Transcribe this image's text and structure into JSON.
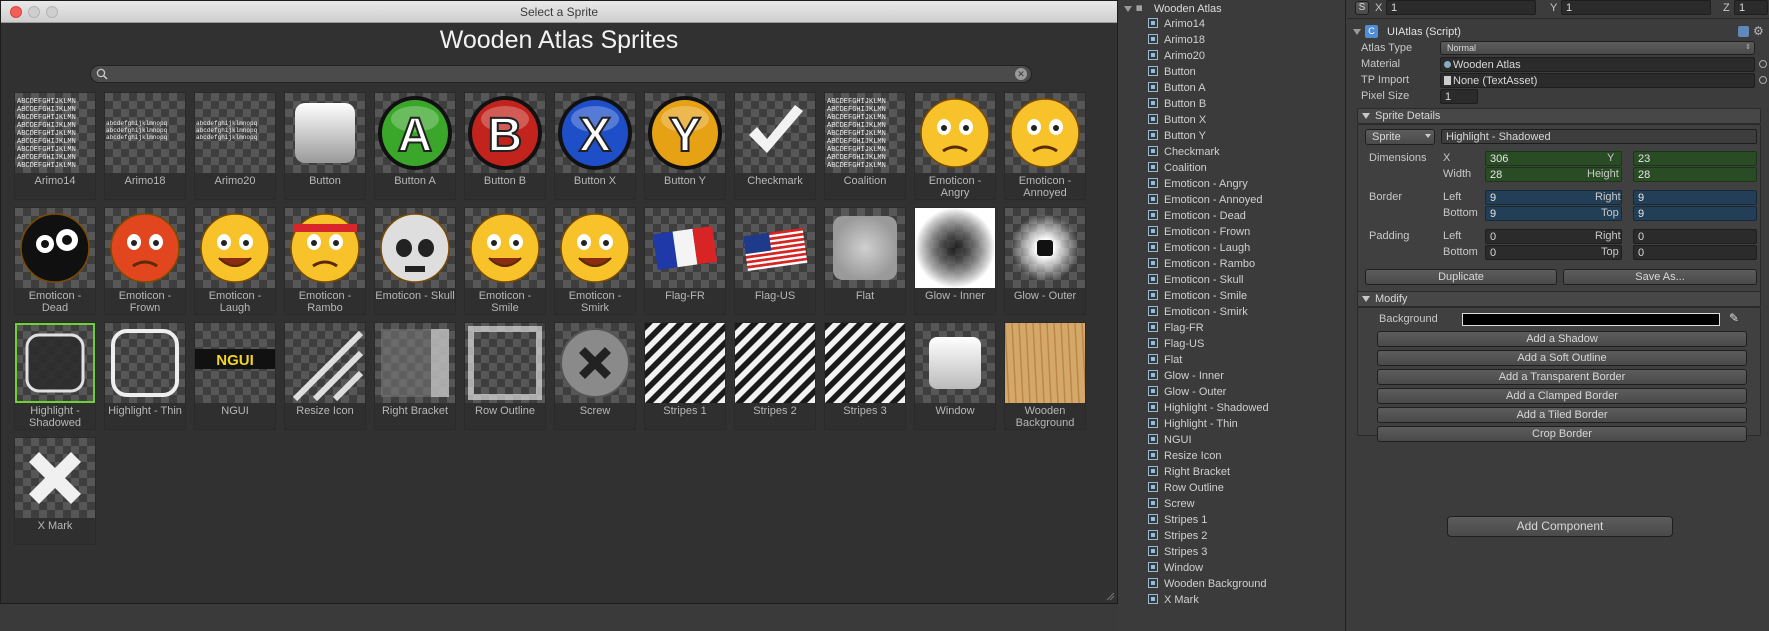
{
  "picker": {
    "window_title": "Select a Sprite",
    "heading": "Wooden Atlas Sprites",
    "search_placeholder": "",
    "sprites": [
      {
        "label": "Arimo14",
        "kind": "font"
      },
      {
        "label": "Arimo18",
        "kind": "font-strip"
      },
      {
        "label": "Arimo20",
        "kind": "font-strip"
      },
      {
        "label": "Button",
        "kind": "button"
      },
      {
        "label": "Button A",
        "kind": "round",
        "letter": "A",
        "color": "#3aa62a"
      },
      {
        "label": "Button B",
        "kind": "round",
        "letter": "B",
        "color": "#c2241d"
      },
      {
        "label": "Button X",
        "kind": "round",
        "letter": "X",
        "color": "#1e4fc8"
      },
      {
        "label": "Button Y",
        "kind": "round",
        "letter": "Y",
        "color": "#e6a114"
      },
      {
        "label": "Checkmark",
        "kind": "check"
      },
      {
        "label": "Coalition",
        "kind": "font"
      },
      {
        "label": "Emoticon - Angry",
        "kind": "emoji",
        "mood": "angry"
      },
      {
        "label": "Emoticon - Annoyed",
        "kind": "emoji",
        "mood": "annoyed"
      },
      {
        "label": "Emoticon - Dead",
        "kind": "emoji",
        "mood": "dead"
      },
      {
        "label": "Emoticon - Frown",
        "kind": "emoji",
        "mood": "frown"
      },
      {
        "label": "Emoticon - Laugh",
        "kind": "emoji",
        "mood": "laugh"
      },
      {
        "label": "Emoticon - Rambo",
        "kind": "emoji",
        "mood": "rambo"
      },
      {
        "label": "Emoticon - Skull",
        "kind": "emoji",
        "mood": "skull"
      },
      {
        "label": "Emoticon - Smile",
        "kind": "emoji",
        "mood": "smile"
      },
      {
        "label": "Emoticon - Smirk",
        "kind": "emoji",
        "mood": "smirk"
      },
      {
        "label": "Flag-FR",
        "kind": "flag-fr"
      },
      {
        "label": "Flag-US",
        "kind": "flag-us"
      },
      {
        "label": "Flat",
        "kind": "flat"
      },
      {
        "label": "Glow - Inner",
        "kind": "glow-inner"
      },
      {
        "label": "Glow - Outer",
        "kind": "glow-outer"
      },
      {
        "label": "Highlight - Shadowed",
        "kind": "highlight",
        "selected": true
      },
      {
        "label": "Highlight - Thin",
        "kind": "highlight-thin"
      },
      {
        "label": "NGUI",
        "kind": "logo"
      },
      {
        "label": "Resize Icon",
        "kind": "resize"
      },
      {
        "label": "Right Bracket",
        "kind": "bracket"
      },
      {
        "label": "Row Outline",
        "kind": "row-outline"
      },
      {
        "label": "Screw",
        "kind": "screw"
      },
      {
        "label": "Stripes 1",
        "kind": "stripes"
      },
      {
        "label": "Stripes 2",
        "kind": "stripes"
      },
      {
        "label": "Stripes 3",
        "kind": "stripes"
      },
      {
        "label": "Window",
        "kind": "window"
      },
      {
        "label": "Wooden Background",
        "kind": "wood"
      },
      {
        "label": "X Mark",
        "kind": "xmark"
      }
    ]
  },
  "hierarchy": {
    "root": "Wooden Atlas",
    "items": [
      "Arimo14",
      "Arimo18",
      "Arimo20",
      "Button",
      "Button A",
      "Button B",
      "Button X",
      "Button Y",
      "Checkmark",
      "Coalition",
      "Emoticon - Angry",
      "Emoticon - Annoyed",
      "Emoticon - Dead",
      "Emoticon - Frown",
      "Emoticon - Laugh",
      "Emoticon - Rambo",
      "Emoticon - Skull",
      "Emoticon - Smile",
      "Emoticon - Smirk",
      "Flag-FR",
      "Flag-US",
      "Flat",
      "Glow - Inner",
      "Glow - Outer",
      "Highlight - Shadowed",
      "Highlight - Thin",
      "NGUI",
      "Resize Icon",
      "Right Bracket",
      "Row Outline",
      "Screw",
      "Stripes 1",
      "Stripes 2",
      "Stripes 3",
      "Window",
      "Wooden Background",
      "X Mark"
    ]
  },
  "inspector": {
    "transform": {
      "scale_btn": "S",
      "x_label": "X",
      "x_value": "1",
      "y_label": "Y",
      "y_value": "1",
      "z_label": "Z",
      "z_value": "1"
    },
    "component_title": "UIAtlas (Script)",
    "atlas_type_label": "Atlas Type",
    "atlas_type_value": "Normal",
    "material_label": "Material",
    "material_value": "Wooden Atlas",
    "tp_import_label": "TP Import",
    "tp_import_value": "None (TextAsset)",
    "pixel_size_label": "Pixel Size",
    "pixel_size_value": "1",
    "sprite_details": {
      "title": "Sprite Details",
      "mode": "Sprite",
      "selected_sprite": "Highlight - Shadowed",
      "dimensions_label": "Dimensions",
      "x_label": "X",
      "x_value": "306",
      "y_label": "Y",
      "y_value": "23",
      "width_label": "Width",
      "width_value": "28",
      "height_label": "Height",
      "height_value": "28",
      "border_label": "Border",
      "border_left_label": "Left",
      "border_left": "9",
      "border_right_label": "Right",
      "border_right": "9",
      "border_bottom_label": "Bottom",
      "border_bottom": "9",
      "border_top_label": "Top",
      "border_top": "9",
      "padding_label": "Padding",
      "padding_left_label": "Left",
      "padding_left": "0",
      "padding_right_label": "Right",
      "padding_right": "0",
      "padding_bottom_label": "Bottom",
      "padding_bottom": "0",
      "padding_top_label": "Top",
      "padding_top": "0",
      "duplicate_label": "Duplicate",
      "save_as_label": "Save As..."
    },
    "modify": {
      "title": "Modify",
      "background_label": "Background",
      "background_color": "#000000",
      "buttons": [
        "Add a Shadow",
        "Add a Soft Outline",
        "Add a Transparent Border",
        "Add a Clamped Border",
        "Add a Tiled Border",
        "Crop Border"
      ]
    },
    "add_component_label": "Add Component"
  }
}
